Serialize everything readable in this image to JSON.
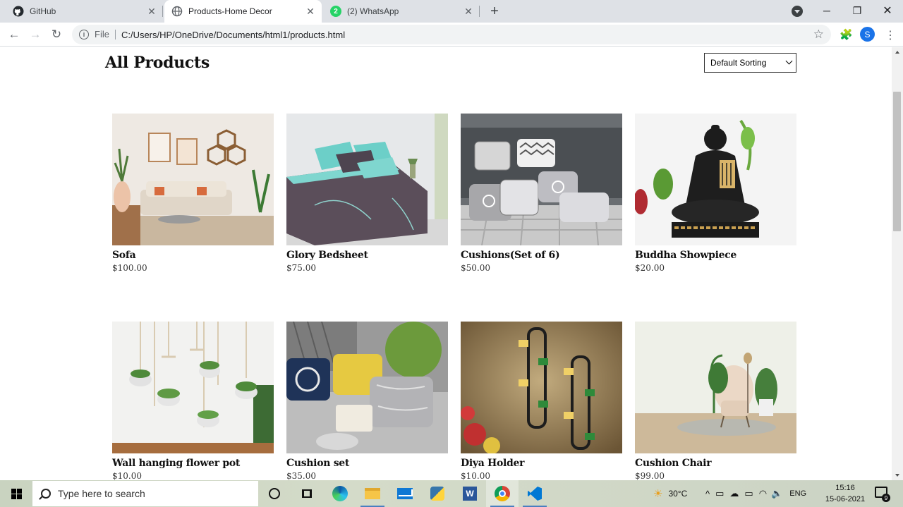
{
  "browser": {
    "tabs": [
      {
        "title": "GitHub",
        "icon": "github-icon",
        "active": false
      },
      {
        "title": "Products-Home Decor",
        "icon": "globe-icon",
        "active": true
      },
      {
        "title": "(2) WhatsApp",
        "icon": "whatsapp-icon",
        "active": false,
        "badge": "2"
      }
    ],
    "address": {
      "scheme_label": "File",
      "url": "C:/Users/HP/OneDrive/Documents/html1/products.html"
    },
    "profile_initial": "S"
  },
  "page": {
    "title": "All Products",
    "sort": {
      "selected": "Default Sorting"
    },
    "products": [
      {
        "name": "Sofa",
        "price": "$100.00"
      },
      {
        "name": "Glory Bedsheet",
        "price": "$75.00"
      },
      {
        "name": "Cushions(Set of 6)",
        "price": "$50.00"
      },
      {
        "name": "Buddha Showpiece",
        "price": "$20.00"
      },
      {
        "name": "Wall hanging flower pot",
        "price": "$10.00"
      },
      {
        "name": "Cushion set",
        "price": "$35.00"
      },
      {
        "name": "Diya Holder",
        "price": "$10.00"
      },
      {
        "name": "Cushion Chair",
        "price": "$99.00"
      }
    ]
  },
  "taskbar": {
    "search_placeholder": "Type here to search",
    "weather": "30°C",
    "language": "ENG",
    "time": "15:16",
    "date": "15-06-2021",
    "notification_count": "9"
  }
}
